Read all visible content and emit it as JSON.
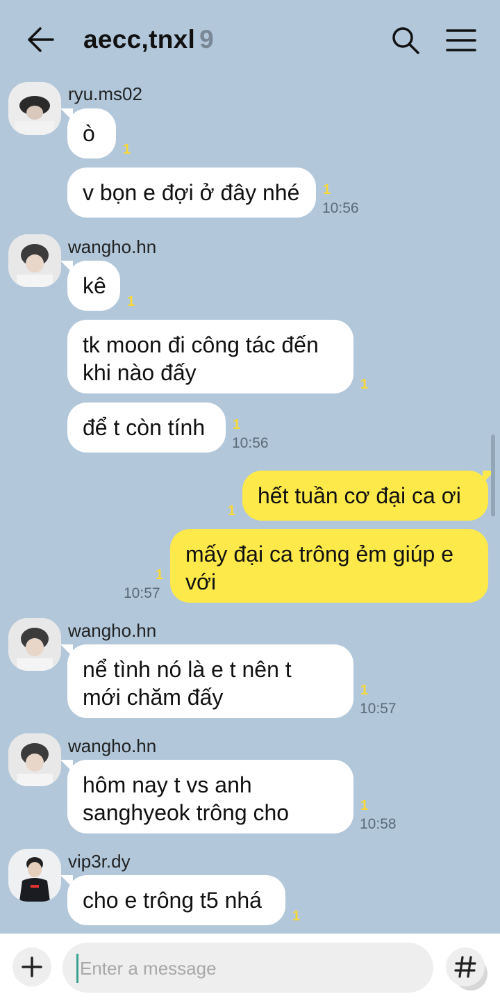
{
  "header": {
    "title": "aecc,tnxl",
    "member_count": "9"
  },
  "messages": {
    "g1": {
      "sender": "ryu.ms02",
      "b1": "ò",
      "b1_unread": "1",
      "b2": "v bọn e đợi ở đây nhé",
      "b2_unread": "1",
      "b2_time": "10:56"
    },
    "g2": {
      "sender": "wangho.hn",
      "b1": "kê",
      "b1_unread": "1",
      "b2": "tk moon đi công tác đến\nkhi nào đấy",
      "b2_unread": "1",
      "b3": "để t còn tính",
      "b3_unread": "1",
      "b3_time": "10:56"
    },
    "me": {
      "b1": "hết tuần cơ đại ca ơi",
      "b1_unread": "1",
      "b2": "mấy đại ca trông ẻm giúp e\nvới",
      "b2_unread": "1",
      "b2_time": "10:57"
    },
    "g3": {
      "sender": "wangho.hn",
      "b1": "nể tình nó là e t nên t\nmới chăm đấy",
      "b1_unread": "1",
      "b1_time": "10:57"
    },
    "g4": {
      "sender": "wangho.hn",
      "b1": "hôm nay t vs anh\nsanghyeok trông cho",
      "b1_unread": "1",
      "b1_time": "10:58"
    },
    "g5": {
      "sender": "vip3r.dy",
      "b1": "cho e trông t5 nhá",
      "b1_unread": "1"
    }
  },
  "input": {
    "placeholder": "Enter a message"
  },
  "icons": {
    "back": "arrow-left-icon",
    "search": "search-icon",
    "menu": "hamburger-icon",
    "plus": "plus-icon",
    "emoji": "emoji-icon",
    "hash": "hash-icon"
  },
  "colors": {
    "background": "#b2c7da",
    "my_bubble": "#fee94a",
    "other_bubble": "#ffffff",
    "unread": "#f7d836"
  }
}
